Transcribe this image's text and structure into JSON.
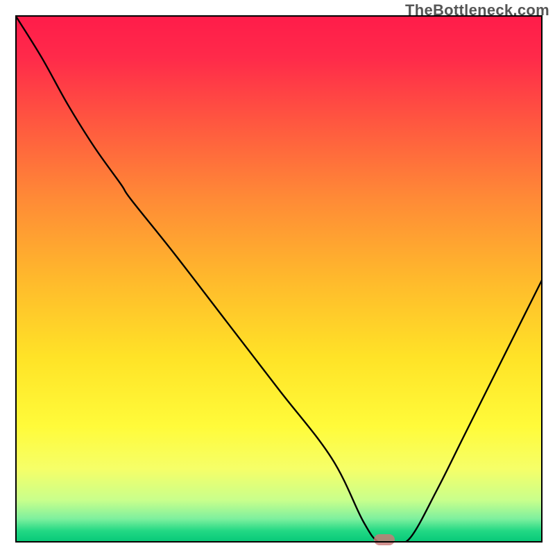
{
  "attribution": "TheBottleneck.com",
  "chart_data": {
    "type": "line",
    "title": "",
    "xlabel": "",
    "ylabel": "",
    "xlim": [
      0,
      100
    ],
    "ylim": [
      0,
      100
    ],
    "series": [
      {
        "name": "bottleneck-curve",
        "x": [
          0,
          5,
          10,
          15,
          20,
          22,
          30,
          40,
          50,
          60,
          66,
          69,
          72,
          75,
          80,
          85,
          90,
          95,
          100
        ],
        "y": [
          100,
          92,
          83,
          75,
          68,
          65,
          55,
          42,
          29,
          16,
          4,
          0,
          0,
          1,
          10,
          20,
          30,
          40,
          50
        ]
      }
    ],
    "marker": {
      "x": 70,
      "y": 0
    },
    "gradient_stops": [
      {
        "offset": 0.0,
        "color": "#ff1c4a"
      },
      {
        "offset": 0.08,
        "color": "#ff2a4a"
      },
      {
        "offset": 0.2,
        "color": "#ff5640"
      },
      {
        "offset": 0.35,
        "color": "#ff8b36"
      },
      {
        "offset": 0.5,
        "color": "#ffb92c"
      },
      {
        "offset": 0.65,
        "color": "#ffe327"
      },
      {
        "offset": 0.78,
        "color": "#fffb3a"
      },
      {
        "offset": 0.86,
        "color": "#f6ff68"
      },
      {
        "offset": 0.92,
        "color": "#c8ff8c"
      },
      {
        "offset": 0.955,
        "color": "#7ef09e"
      },
      {
        "offset": 0.978,
        "color": "#22d884"
      },
      {
        "offset": 1.0,
        "color": "#05c878"
      }
    ]
  }
}
